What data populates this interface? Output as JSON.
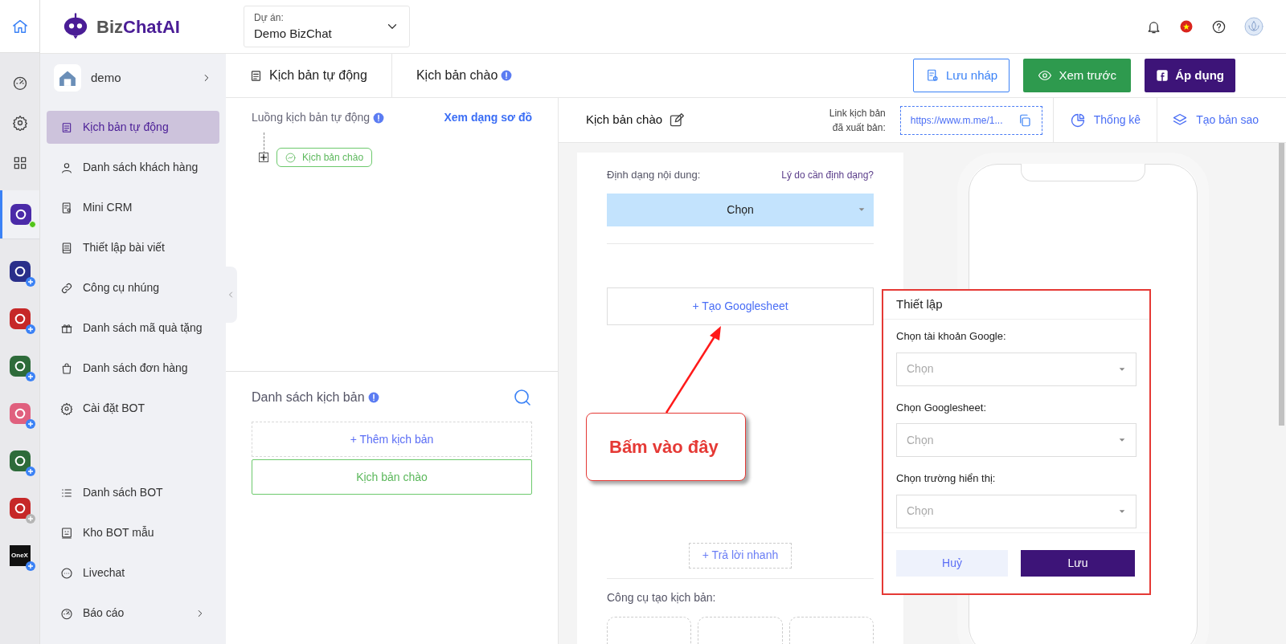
{
  "rail": {
    "tools": [
      {
        "selected": false
      },
      {
        "selected": false
      },
      {
        "selected": false
      }
    ],
    "apps": [
      {
        "color": "#4a2aa8",
        "selected": true,
        "online": true
      },
      {
        "color": "#2a2f8a",
        "selected": false,
        "available": true
      },
      {
        "color": "#c62828",
        "selected": false,
        "available": true
      },
      {
        "color": "#2e6b3a",
        "selected": false,
        "available": true
      },
      {
        "color": "#e0607e",
        "selected": false,
        "available": true
      },
      {
        "color": "#2e6b3a",
        "selected": false,
        "available": true
      },
      {
        "color": "#c62828",
        "selected": false,
        "available": false
      },
      {
        "color": "#111111",
        "selected": false,
        "available": true,
        "label": "OneX"
      }
    ]
  },
  "header": {
    "brand": {
      "part_1": "Biz",
      "part_2": "ChatAI"
    },
    "project": {
      "label": "Dự án:",
      "value": "Demo BizChat"
    }
  },
  "sidebar": {
    "account": "demo",
    "sections": [
      {
        "items": [
          {
            "label": "Kịch bản tự động",
            "selected": true,
            "expandable": false
          },
          {
            "label": "Danh sách khách hàng",
            "selected": false,
            "expandable": false
          },
          {
            "label": "Mini CRM",
            "selected": false,
            "expandable": false
          },
          {
            "label": "Thiết lập bài viết",
            "selected": false,
            "expandable": false
          },
          {
            "label": "Công cụ nhúng",
            "selected": false,
            "expandable": false
          },
          {
            "label": "Danh sách mã quà tặng",
            "selected": false,
            "expandable": false
          },
          {
            "label": "Danh sách đơn hàng",
            "selected": false,
            "expandable": false
          },
          {
            "label": "Cài đặt BOT",
            "selected": false,
            "expandable": false
          }
        ]
      },
      {
        "items": [
          {
            "label": "Danh sách BOT",
            "selected": false,
            "expandable": false
          },
          {
            "label": "Kho BOT mẫu",
            "selected": false,
            "expandable": false
          },
          {
            "label": "Livechat",
            "selected": false,
            "expandable": false
          },
          {
            "label": "Báo cáo",
            "selected": false,
            "expandable": true
          }
        ]
      }
    ]
  },
  "breadcrumb": [
    "Kịch bản tự động",
    "Kịch bản chào"
  ],
  "actions": [
    {
      "kind": "outline",
      "label": "Lưu nháp"
    },
    {
      "kind": "green",
      "label": "Xem trước"
    },
    {
      "kind": "purple",
      "label": "Áp dụng"
    }
  ],
  "flow": {
    "title": "Luồng kịch bản tự động",
    "view_link": "Xem dạng sơ đồ",
    "node": "Kịch bản chào"
  },
  "scripts": {
    "title": "Danh sách kịch bản",
    "add": "+ Thêm kịch bản",
    "items": [
      {
        "label": "Kịch bản chào",
        "selected": true
      }
    ]
  },
  "toolbar": {
    "name": "Kịch bản chào",
    "link_label_1": "Link kịch bản",
    "link_label_2": "đã xuất bản:",
    "link": "https://www.m.me/1...",
    "stats": "Thống kê",
    "copy": "Tạo bản sao"
  },
  "editor": {
    "format_label": "Định dạng nội dung:",
    "format_help": "Lý do cần định dạng?",
    "format_value": "Chọn",
    "create_sheet": "+ Tạo Googlesheet",
    "quick_reply": "+ Trả lời nhanh",
    "tools_label": "Công cụ tạo kịch bản:"
  },
  "popup": {
    "title": "Thiết lập",
    "fields": [
      {
        "label": "Chọn tài khoản Google:",
        "placeholder": "Chọn"
      },
      {
        "label": "Chọn Googlesheet:",
        "placeholder": "Chọn"
      },
      {
        "label": "Chọn trường hiển thị:",
        "placeholder": "Chọn"
      }
    ],
    "cancel": "Huỷ",
    "save": "Lưu"
  },
  "annotation": {
    "text": "Bấm vào đây"
  }
}
